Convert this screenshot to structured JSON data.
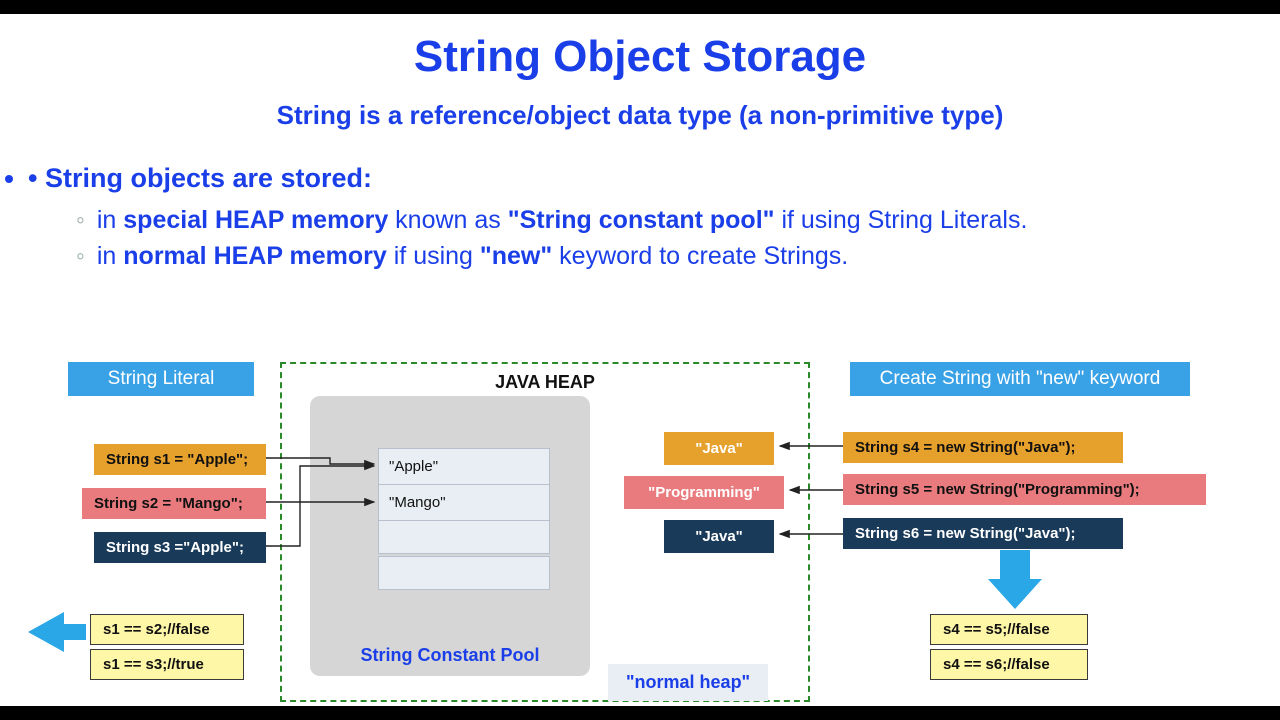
{
  "title": "String Object Storage",
  "subtitle": "String is a reference/object data type (a non-primitive type)",
  "bullets": {
    "lead": "String objects are stored:",
    "sub1a": "in ",
    "sub1b": "special HEAP memory",
    "sub1c": " known as ",
    "sub1d": "\"String constant pool\"",
    "sub1e": " if using String Literals.",
    "sub2a": "in ",
    "sub2b": "normal HEAP memory",
    "sub2c": " if using ",
    "sub2d": "\"new\"",
    "sub2e": " keyword to create Strings."
  },
  "headers": {
    "left": "String Literal",
    "heap": "JAVA HEAP",
    "scp": "String Constant Pool",
    "right": "Create String with \"new\" keyword",
    "normal": "\"normal heap\""
  },
  "left_code": {
    "s1": "String s1 = \"Apple\";",
    "s2": "String s2 = \"Mango\";",
    "s3": "String s3 =\"Apple\";"
  },
  "pool": {
    "v1": "\"Apple\"",
    "v2": "\"Mango\""
  },
  "left_cmp": {
    "c1": "s1 == s2;//false",
    "c2": "s1 == s3;//true"
  },
  "heap_vals": {
    "v1": "\"Java\"",
    "v2": "\"Programming\"",
    "v3": "\"Java\""
  },
  "right_code": {
    "s4": "String s4 = new String(\"Java\");",
    "s5": "String s5 = new String(\"Programming\");",
    "s6": "String s6 = new String(\"Java\");"
  },
  "right_cmp": {
    "c1": "s4 == s5;//false",
    "c2": "s4 == s6;//false"
  }
}
